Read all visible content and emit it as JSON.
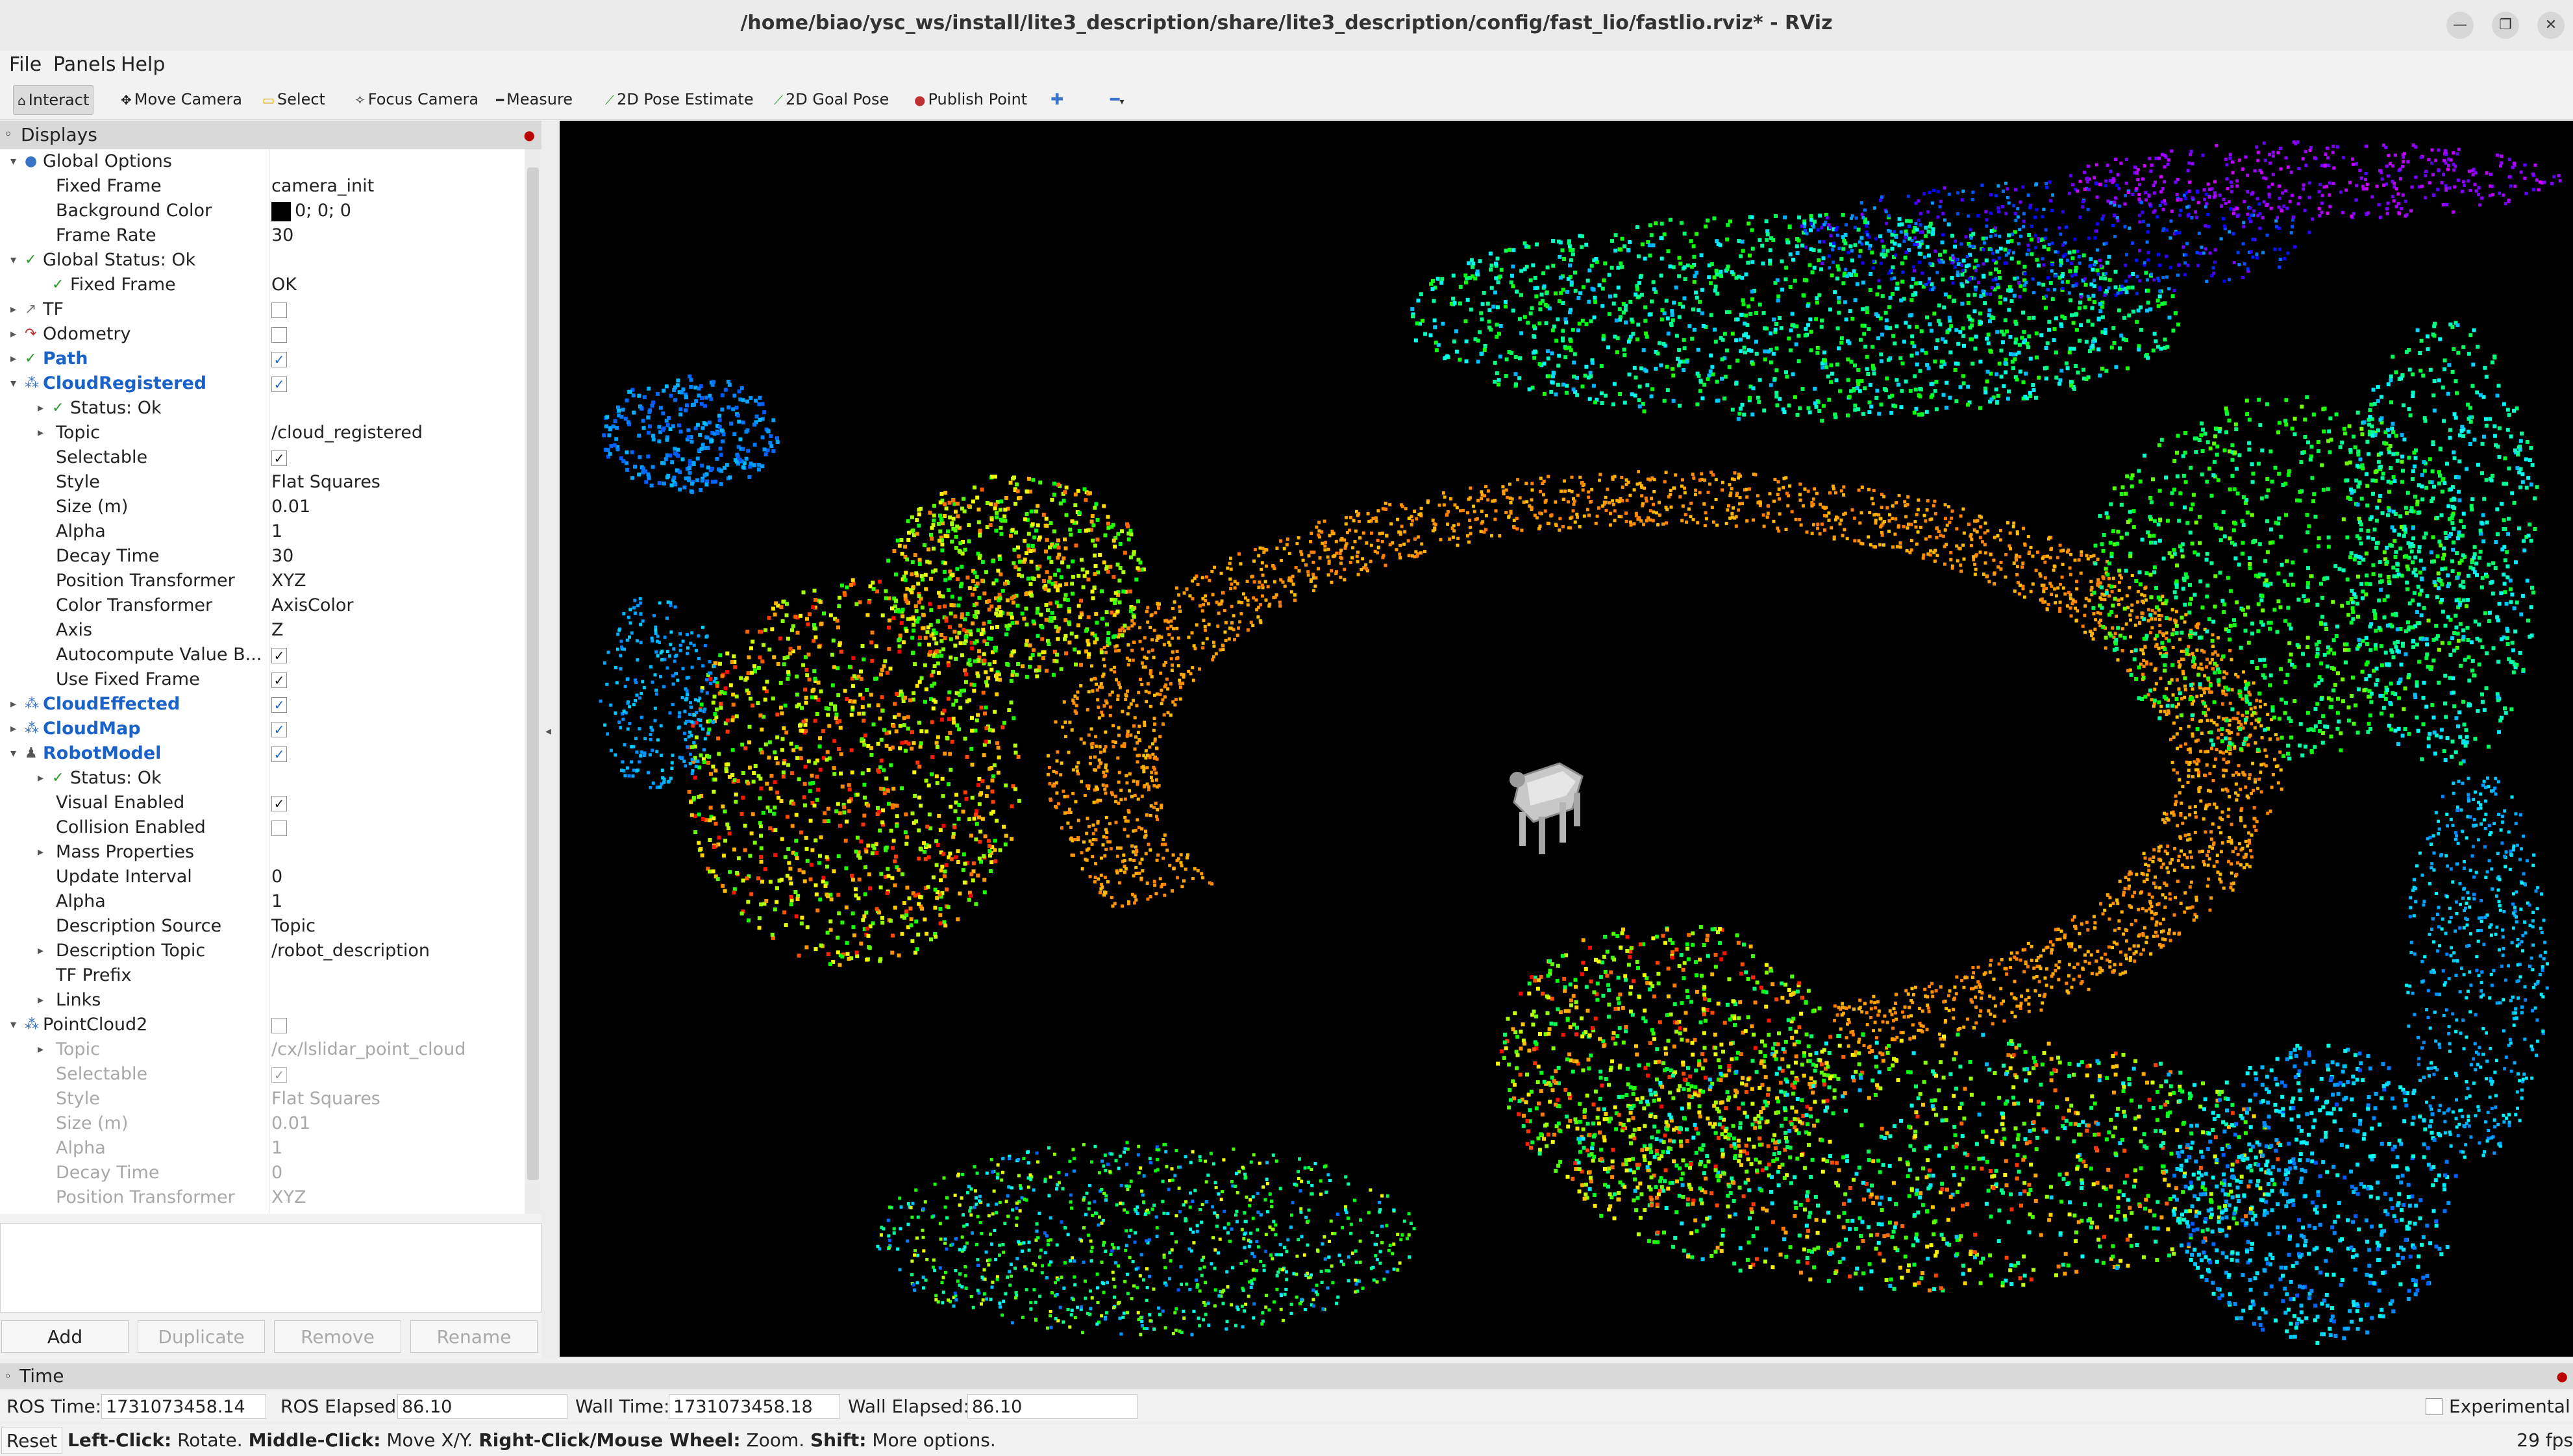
{
  "window": {
    "title": "/home/biao/ysc_ws/install/lite3_description/share/lite3_description/config/fast_lio/fastlio.rviz* - RViz",
    "buttons": [
      "minimize-icon",
      "restore-icon",
      "close-icon"
    ]
  },
  "menu": [
    "File",
    "Panels",
    "Help"
  ],
  "toolbar": [
    {
      "label": "Interact",
      "icon": "interact-icon",
      "active": true
    },
    {
      "label": "Move Camera",
      "icon": "move-camera-icon"
    },
    {
      "label": "Select",
      "icon": "select-icon"
    },
    {
      "label": "Focus Camera",
      "icon": "focus-camera-icon"
    },
    {
      "label": "Measure",
      "icon": "measure-icon"
    },
    {
      "label": "2D Pose Estimate",
      "icon": "pose-estimate-icon"
    },
    {
      "label": "2D Goal Pose",
      "icon": "goal-pose-icon"
    },
    {
      "label": "Publish Point",
      "icon": "publish-point-icon"
    }
  ],
  "displays": {
    "title": "Displays",
    "rows": [
      {
        "indent": 0,
        "arrow": "▾",
        "icon": "●",
        "icon_color": "#3a74c8",
        "label": "Global Options",
        "value": ""
      },
      {
        "indent": 1,
        "arrow": "",
        "icon": "",
        "label": "Fixed Frame",
        "value": "camera_init"
      },
      {
        "indent": 1,
        "arrow": "",
        "icon": "",
        "label": "Background Color",
        "value": "0; 0; 0",
        "swatch": "#000000"
      },
      {
        "indent": 1,
        "arrow": "",
        "icon": "",
        "label": "Frame Rate",
        "value": "30"
      },
      {
        "indent": 0,
        "arrow": "▾",
        "icon": "✓",
        "icon_color": "#2a9a2a",
        "label": "Global Status: Ok",
        "value": ""
      },
      {
        "indent": 1,
        "arrow": "",
        "icon": "✓",
        "icon_color": "#2a9a2a",
        "label": "Fixed Frame",
        "value": "OK"
      },
      {
        "indent": 0,
        "arrow": "▸",
        "icon": "↗",
        "icon_color": "#777",
        "label": "TF",
        "check": ""
      },
      {
        "indent": 0,
        "arrow": "▸",
        "icon": "↷",
        "icon_color": "#c03030",
        "label": "Odometry",
        "check": ""
      },
      {
        "indent": 0,
        "arrow": "▸",
        "icon": "✓",
        "icon_color": "#2a9a2a",
        "label": "Path",
        "check": "✓",
        "blue": true
      },
      {
        "indent": 0,
        "arrow": "▾",
        "icon": "⁂",
        "icon_color": "#3a74c8",
        "label": "CloudRegistered",
        "check": "✓",
        "blue": true
      },
      {
        "indent": 1,
        "arrow": "▸",
        "icon": "✓",
        "icon_color": "#2a9a2a",
        "label": "Status: Ok",
        "value": ""
      },
      {
        "indent": 1,
        "arrow": "▸",
        "icon": "",
        "label": "Topic",
        "value": "/cloud_registered"
      },
      {
        "indent": 1,
        "arrow": "",
        "icon": "",
        "label": "Selectable",
        "check": "✓"
      },
      {
        "indent": 1,
        "arrow": "",
        "icon": "",
        "label": "Style",
        "value": "Flat Squares"
      },
      {
        "indent": 1,
        "arrow": "",
        "icon": "",
        "label": "Size (m)",
        "value": "0.01"
      },
      {
        "indent": 1,
        "arrow": "",
        "icon": "",
        "label": "Alpha",
        "value": "1"
      },
      {
        "indent": 1,
        "arrow": "",
        "icon": "",
        "label": "Decay Time",
        "value": "30"
      },
      {
        "indent": 1,
        "arrow": "",
        "icon": "",
        "label": "Position Transformer",
        "value": "XYZ"
      },
      {
        "indent": 1,
        "arrow": "",
        "icon": "",
        "label": "Color Transformer",
        "value": "AxisColor"
      },
      {
        "indent": 1,
        "arrow": "",
        "icon": "",
        "label": "Axis",
        "value": "Z"
      },
      {
        "indent": 1,
        "arrow": "",
        "icon": "",
        "label": "Autocompute Value B...",
        "check": "✓"
      },
      {
        "indent": 1,
        "arrow": "",
        "icon": "",
        "label": "Use Fixed Frame",
        "check": "✓"
      },
      {
        "indent": 0,
        "arrow": "▸",
        "icon": "⁂",
        "icon_color": "#3a74c8",
        "label": "CloudEffected",
        "check": "✓",
        "blue": true
      },
      {
        "indent": 0,
        "arrow": "▸",
        "icon": "⁂",
        "icon_color": "#3a74c8",
        "label": "CloudMap",
        "check": "✓",
        "blue": true
      },
      {
        "indent": 0,
        "arrow": "▾",
        "icon": "♟",
        "icon_color": "#555",
        "label": "RobotModel",
        "check": "✓",
        "blue": true
      },
      {
        "indent": 1,
        "arrow": "▸",
        "icon": "✓",
        "icon_color": "#2a9a2a",
        "label": "Status: Ok",
        "value": ""
      },
      {
        "indent": 1,
        "arrow": "",
        "icon": "",
        "label": "Visual Enabled",
        "check": "✓"
      },
      {
        "indent": 1,
        "arrow": "",
        "icon": "",
        "label": "Collision Enabled",
        "check": ""
      },
      {
        "indent": 1,
        "arrow": "▸",
        "icon": "",
        "label": "Mass Properties",
        "value": ""
      },
      {
        "indent": 1,
        "arrow": "",
        "icon": "",
        "label": "Update Interval",
        "value": "0"
      },
      {
        "indent": 1,
        "arrow": "",
        "icon": "",
        "label": "Alpha",
        "value": "1"
      },
      {
        "indent": 1,
        "arrow": "",
        "icon": "",
        "label": "Description Source",
        "value": "Topic"
      },
      {
        "indent": 1,
        "arrow": "▸",
        "icon": "",
        "label": "Description Topic",
        "value": "/robot_description"
      },
      {
        "indent": 1,
        "arrow": "",
        "icon": "",
        "label": "TF Prefix",
        "value": ""
      },
      {
        "indent": 1,
        "arrow": "▸",
        "icon": "",
        "label": "Links",
        "value": ""
      },
      {
        "indent": 0,
        "arrow": "▾",
        "icon": "⁂",
        "icon_color": "#3a74c8",
        "label": "PointCloud2",
        "check": ""
      },
      {
        "indent": 1,
        "arrow": "▸",
        "icon": "",
        "label": "Topic",
        "value": "/cx/lslidar_point_cloud",
        "disabled": true
      },
      {
        "indent": 1,
        "arrow": "",
        "icon": "",
        "label": "Selectable",
        "check": "✓",
        "disabled": true
      },
      {
        "indent": 1,
        "arrow": "",
        "icon": "",
        "label": "Style",
        "value": "Flat Squares",
        "disabled": true
      },
      {
        "indent": 1,
        "arrow": "",
        "icon": "",
        "label": "Size (m)",
        "value": "0.01",
        "disabled": true
      },
      {
        "indent": 1,
        "arrow": "",
        "icon": "",
        "label": "Alpha",
        "value": "1",
        "disabled": true
      },
      {
        "indent": 1,
        "arrow": "",
        "icon": "",
        "label": "Decay Time",
        "value": "0",
        "disabled": true
      },
      {
        "indent": 1,
        "arrow": "",
        "icon": "",
        "label": "Position Transformer",
        "value": "XYZ",
        "disabled": true
      }
    ],
    "buttons": {
      "add": "Add",
      "duplicate": "Duplicate",
      "remove": "Remove",
      "rename": "Rename"
    }
  },
  "time": {
    "title": "Time",
    "ros_time_label": "ROS Time:",
    "ros_time": "1731073458.14",
    "ros_elapsed_label": "ROS Elapsed:",
    "ros_elapsed": "86.10",
    "wall_time_label": "Wall Time:",
    "wall_time": "1731073458.18",
    "wall_elapsed_label": "Wall Elapsed:",
    "wall_elapsed": "86.10",
    "experimental": "Experimental"
  },
  "status": {
    "reset": "Reset",
    "help": [
      {
        "b": "Left-Click:",
        "t": " Rotate. "
      },
      {
        "b": "Middle-Click:",
        "t": " Move X/Y. "
      },
      {
        "b": "Right-Click/Mouse Wheel:",
        "t": " Zoom. "
      },
      {
        "b": "Shift:",
        "t": " More options."
      }
    ],
    "fps": "29 fps"
  }
}
